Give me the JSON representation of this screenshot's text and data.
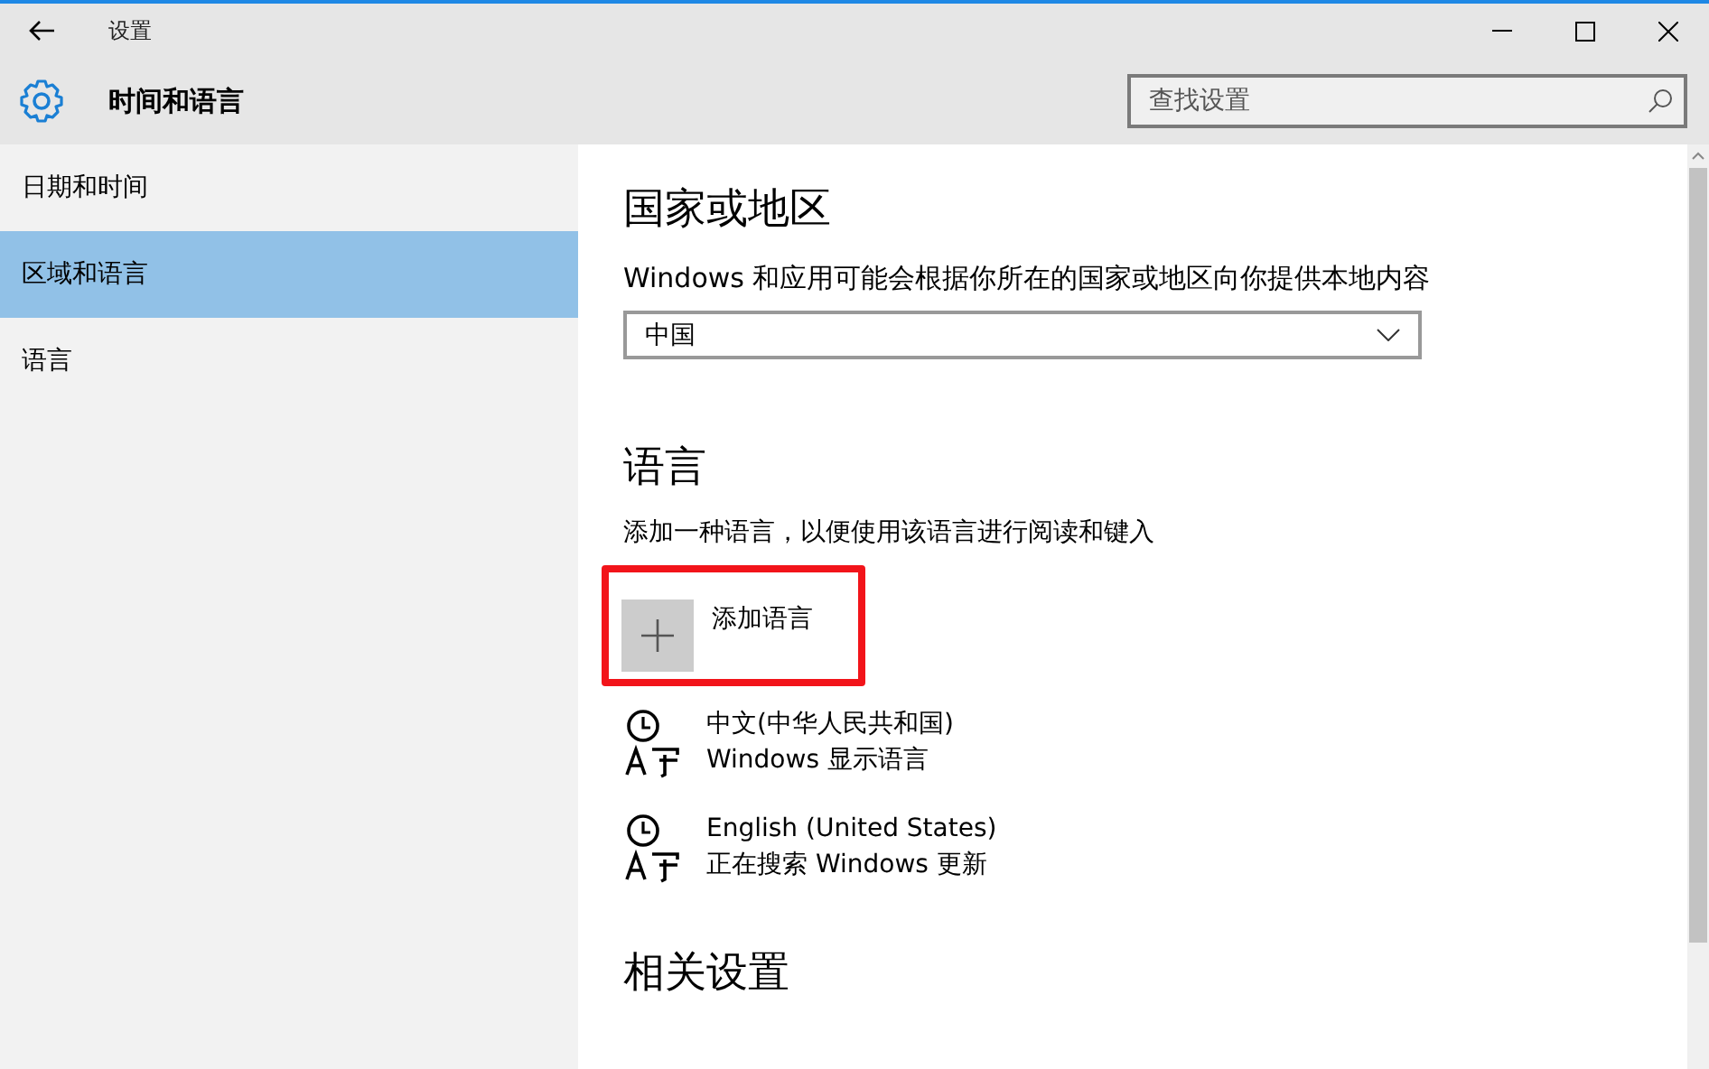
{
  "window": {
    "title": "设置"
  },
  "header": {
    "title": "时间和语言",
    "search": {
      "placeholder": "查找设置"
    }
  },
  "sidebar": {
    "items": [
      {
        "label": "日期和时间",
        "selected": false
      },
      {
        "label": "区域和语言",
        "selected": true
      },
      {
        "label": "语言",
        "selected": false
      }
    ]
  },
  "region": {
    "heading": "国家或地区",
    "description": "Windows 和应用可能会根据你所在的国家或地区向你提供本地内容",
    "select": {
      "value": "中国"
    }
  },
  "language": {
    "heading": "语言",
    "description": "添加一种语言，以便使用该语言进行阅读和键入",
    "add_button": {
      "label": "添加语言",
      "highlighted": true
    },
    "items": [
      {
        "name": "中文(中华人民共和国)",
        "status": "Windows 显示语言"
      },
      {
        "name": "English (United States)",
        "status": "正在搜索 Windows 更新"
      }
    ]
  },
  "related": {
    "heading": "相关设置"
  }
}
